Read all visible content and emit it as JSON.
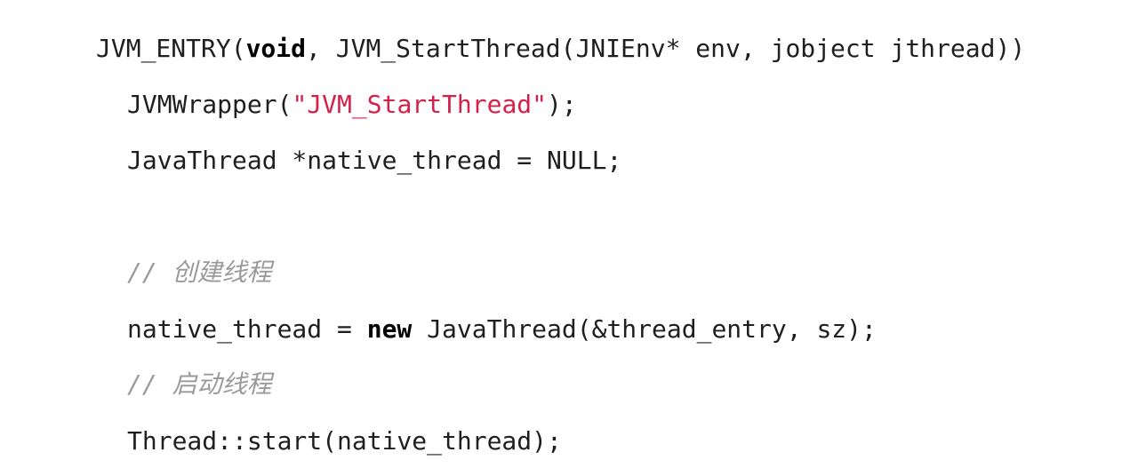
{
  "code": {
    "line1": {
      "prefix": "JVM_ENTRY(",
      "keyword": "void",
      "suffix": ", JVM_StartThread(JNIEnv* env, jobject jthread))"
    },
    "line2": {
      "prefix": "JVMWrapper(",
      "string": "\"JVM_StartThread\"",
      "suffix": ");"
    },
    "line3": {
      "text": "JavaThread *native_thread = NULL;"
    },
    "line4": {
      "comment": "// 创建线程"
    },
    "line5": {
      "prefix": "native_thread = ",
      "keyword": "new",
      "suffix": " JavaThread(&thread_entry, sz);"
    },
    "line6": {
      "comment": "// 启动线程"
    },
    "line7": {
      "text": "Thread::start(native_thread);"
    }
  }
}
